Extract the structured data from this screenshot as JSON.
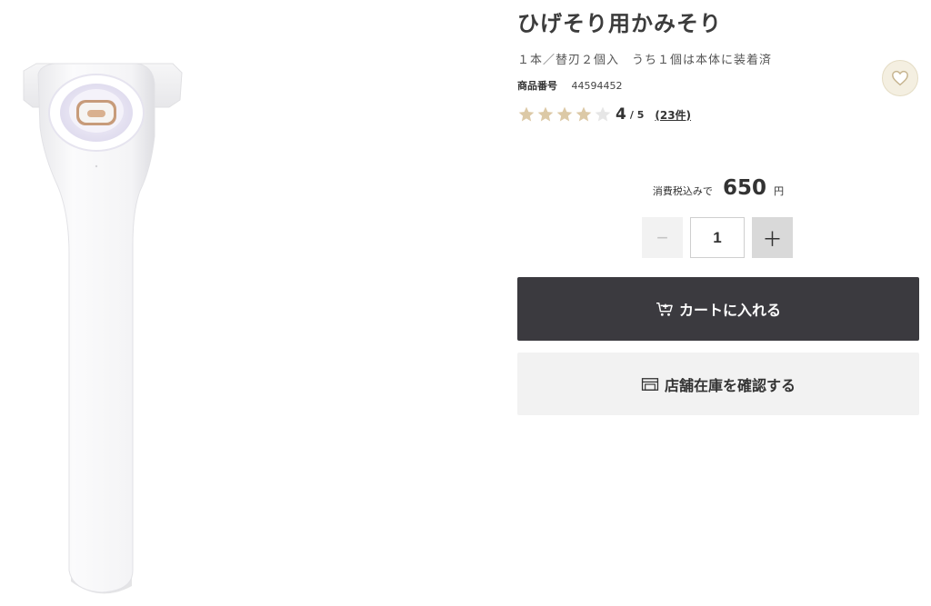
{
  "product": {
    "title": "ひげそり用かみそり",
    "subtitle": "１本／替刃２個入　うち１個は本体に装着済",
    "sku_label": "商品番号",
    "sku_value": "44594452",
    "image_icon": "razor-product-image"
  },
  "rating": {
    "value": 4,
    "max": 5,
    "score": "4",
    "max_label": "/ 5",
    "count_label": "(23件)",
    "star_filled_color": "#dcc9a6",
    "star_empty_color": "#e6e6e6"
  },
  "favorite": {
    "icon": "heart-icon"
  },
  "price": {
    "label": "消費税込みで",
    "value": "650",
    "unit": "円"
  },
  "quantity": {
    "value": "1",
    "minus_label": "−",
    "plus_label": "＋"
  },
  "actions": {
    "cart_label": "カートに入れる",
    "cart_icon": "cart-icon",
    "store_label": "店舗在庫を確認する",
    "store_icon": "store-icon"
  },
  "colors": {
    "cart_bg": "#3b3a3f",
    "store_bg": "#f2f2f2",
    "favorite_bg": "#f4efe1"
  }
}
